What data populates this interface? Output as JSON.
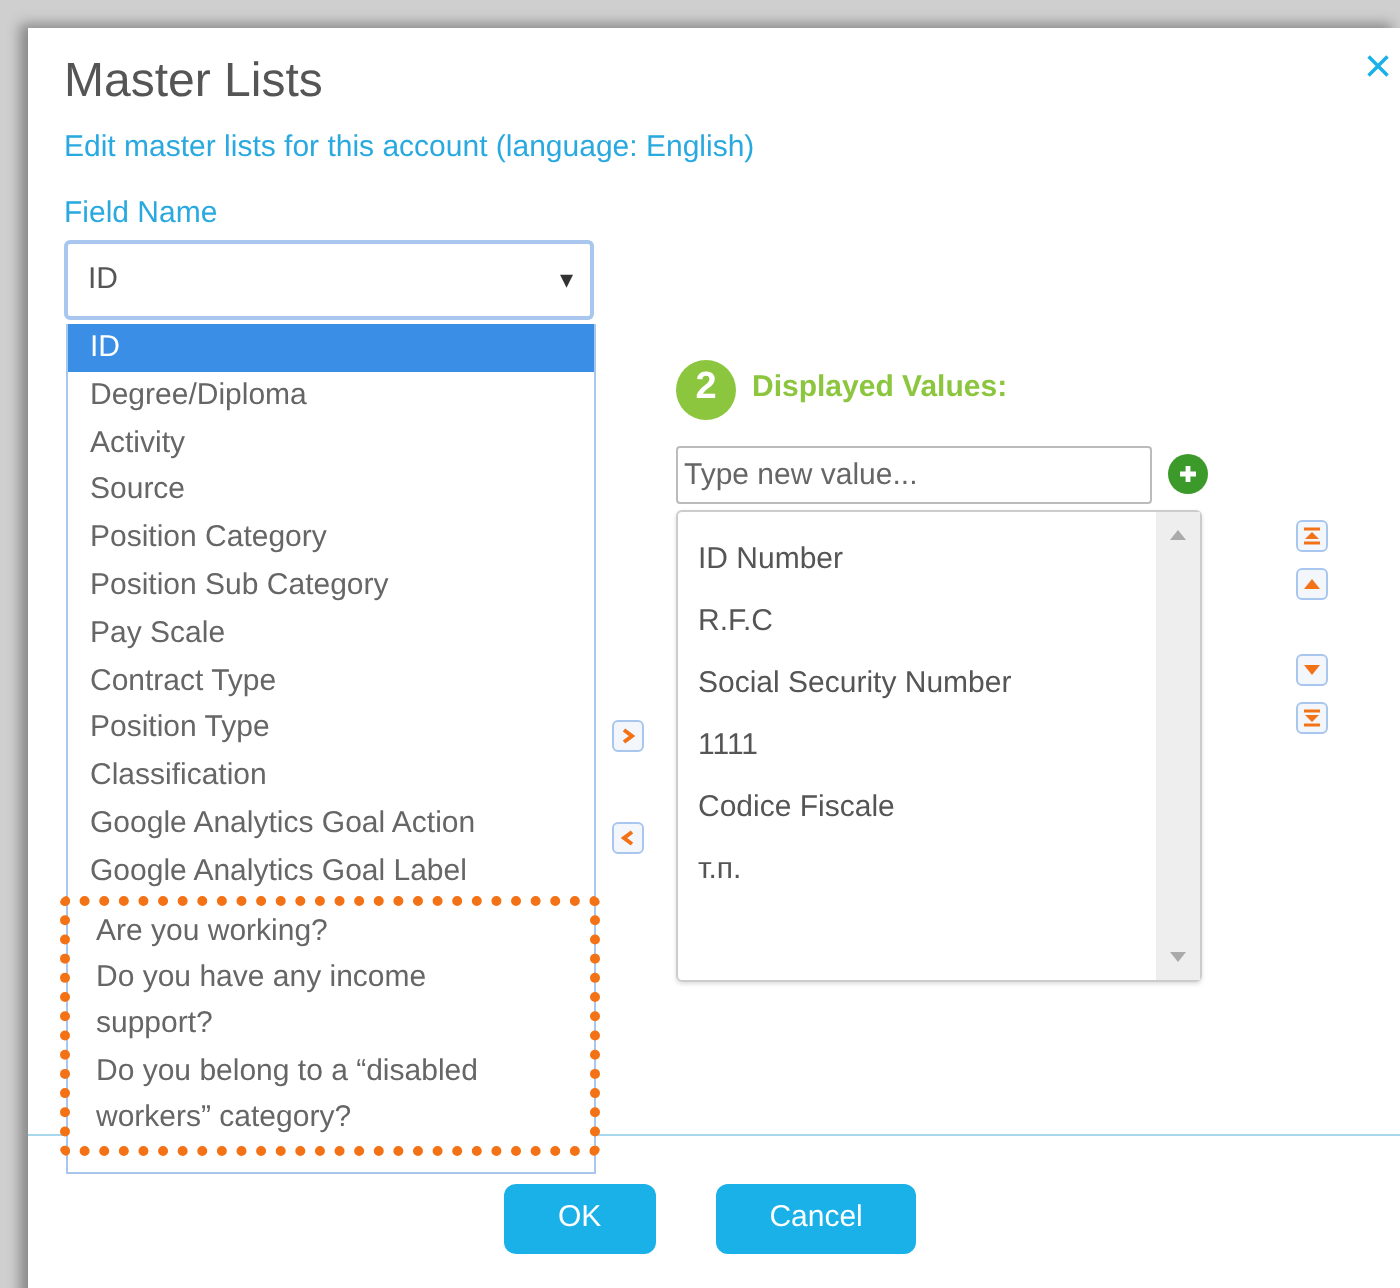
{
  "dialog": {
    "title": "Master Lists",
    "close": "×",
    "subtitle": "Edit master lists for this account (language: English)"
  },
  "field_name": {
    "label": "Field Name",
    "value": "ID",
    "caret": "▾"
  },
  "field_options": [
    {
      "label": "ID",
      "selected": true,
      "highlighted": false
    },
    {
      "label": "Degree/Diploma",
      "selected": false,
      "highlighted": false
    },
    {
      "label": "Activity",
      "selected": false,
      "highlighted": false
    },
    {
      "label": "Source",
      "selected": false,
      "highlighted": false
    },
    {
      "label": "Position Category",
      "selected": false,
      "highlighted": false
    },
    {
      "label": "Position Sub Category",
      "selected": false,
      "highlighted": false
    },
    {
      "label": "Pay Scale",
      "selected": false,
      "highlighted": false
    },
    {
      "label": "Contract Type",
      "selected": false,
      "highlighted": false
    },
    {
      "label": "Position Type",
      "selected": false,
      "highlighted": false
    },
    {
      "label": "Classification",
      "selected": false,
      "highlighted": false
    },
    {
      "label": "Google Analytics Goal Action",
      "selected": false,
      "highlighted": false
    },
    {
      "label": "Google Analytics Goal Label",
      "selected": false,
      "highlighted": false
    },
    {
      "label": "Are you working?",
      "selected": false,
      "highlighted": true
    },
    {
      "label": "Do you have any income support?",
      "selected": false,
      "highlighted": true
    },
    {
      "label": "Do you belong to a “disabled workers” category?",
      "selected": false,
      "highlighted": true
    }
  ],
  "displayed_values": {
    "step": "2",
    "heading": "Displayed Values:",
    "placeholder": "Type new value...",
    "values": [
      "ID Number",
      "R.F.C",
      "Social Security Number",
      "1111",
      "Codice Fiscale",
      "т.п."
    ]
  },
  "buttons": [
    "OK",
    "Cancel"
  ]
}
